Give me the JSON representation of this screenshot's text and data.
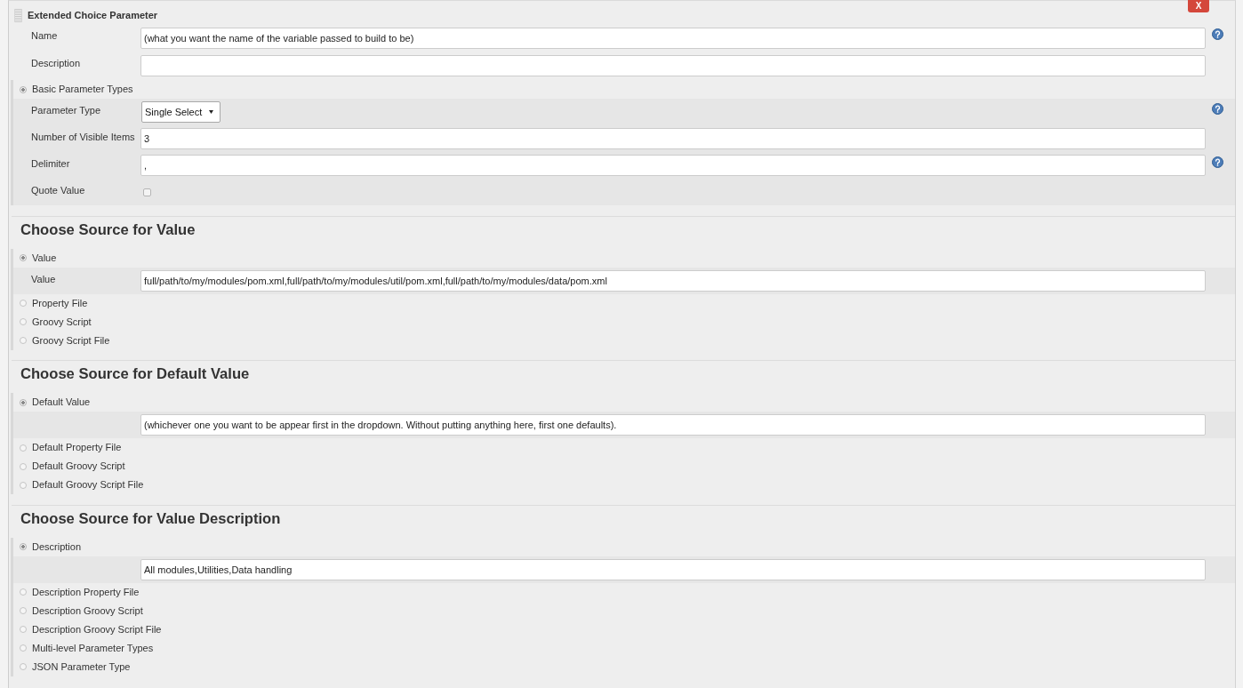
{
  "header": {
    "title": "Extended Choice Parameter",
    "delete_button": "X"
  },
  "fields": [
    {
      "kind": "text",
      "label": "Name",
      "value": "(what you want the name of the variable passed to build to be)",
      "help": true
    },
    {
      "kind": "text",
      "label": "Description",
      "help": false
    }
  ],
  "groups": [
    {
      "options": [
        {
          "label": "Basic Parameter Types",
          "selected": true,
          "fields": [
            {
              "kind": "select",
              "label": "Parameter Type",
              "value": "Single Select",
              "help": true
            },
            {
              "kind": "text",
              "label": "Number of Visible Items",
              "value": "3",
              "help": false
            },
            {
              "kind": "text",
              "label": "Delimiter",
              "value": ",",
              "help": true
            },
            {
              "kind": "checkbox",
              "label": "Quote Value",
              "checked": false,
              "help": false
            }
          ]
        }
      ]
    },
    {
      "heading": "Choose Source for Value",
      "options": [
        {
          "label": "Value",
          "selected": true,
          "fields": [
            {
              "kind": "text",
              "label": "Value",
              "value": "full/path/to/my/modules/pom.xml,full/path/to/my/modules/util/pom.xml,full/path/to/my/modules/data/pom.xml",
              "help": false
            }
          ]
        },
        {
          "label": "Property File",
          "selected": false
        },
        {
          "label": "Groovy Script",
          "selected": false
        },
        {
          "label": "Groovy Script File",
          "selected": false
        }
      ]
    },
    {
      "heading": "Choose Source for Default Value",
      "options": [
        {
          "label": "Default Value",
          "selected": true,
          "fields": [
            {
              "kind": "text",
              "value": "(whichever one you want to be appear first in the dropdown. Without putting anything here, first one defaults).",
              "help": false
            }
          ]
        },
        {
          "label": "Default Property File",
          "selected": false
        },
        {
          "label": "Default Groovy Script",
          "selected": false
        },
        {
          "label": "Default Groovy Script File",
          "selected": false
        }
      ]
    },
    {
      "heading": "Choose Source for Value Description",
      "options": [
        {
          "label": "Description",
          "selected": true,
          "fields": [
            {
              "kind": "text",
              "value": "All modules,Utilities,Data handling",
              "help": false
            }
          ]
        },
        {
          "label": "Description Property File",
          "selected": false
        },
        {
          "label": "Description Groovy Script",
          "selected": false
        },
        {
          "label": "Description Groovy Script File",
          "selected": false
        },
        {
          "label": "Multi-level Parameter Types",
          "selected": false
        },
        {
          "label": "JSON Parameter Type",
          "selected": false
        }
      ]
    }
  ]
}
